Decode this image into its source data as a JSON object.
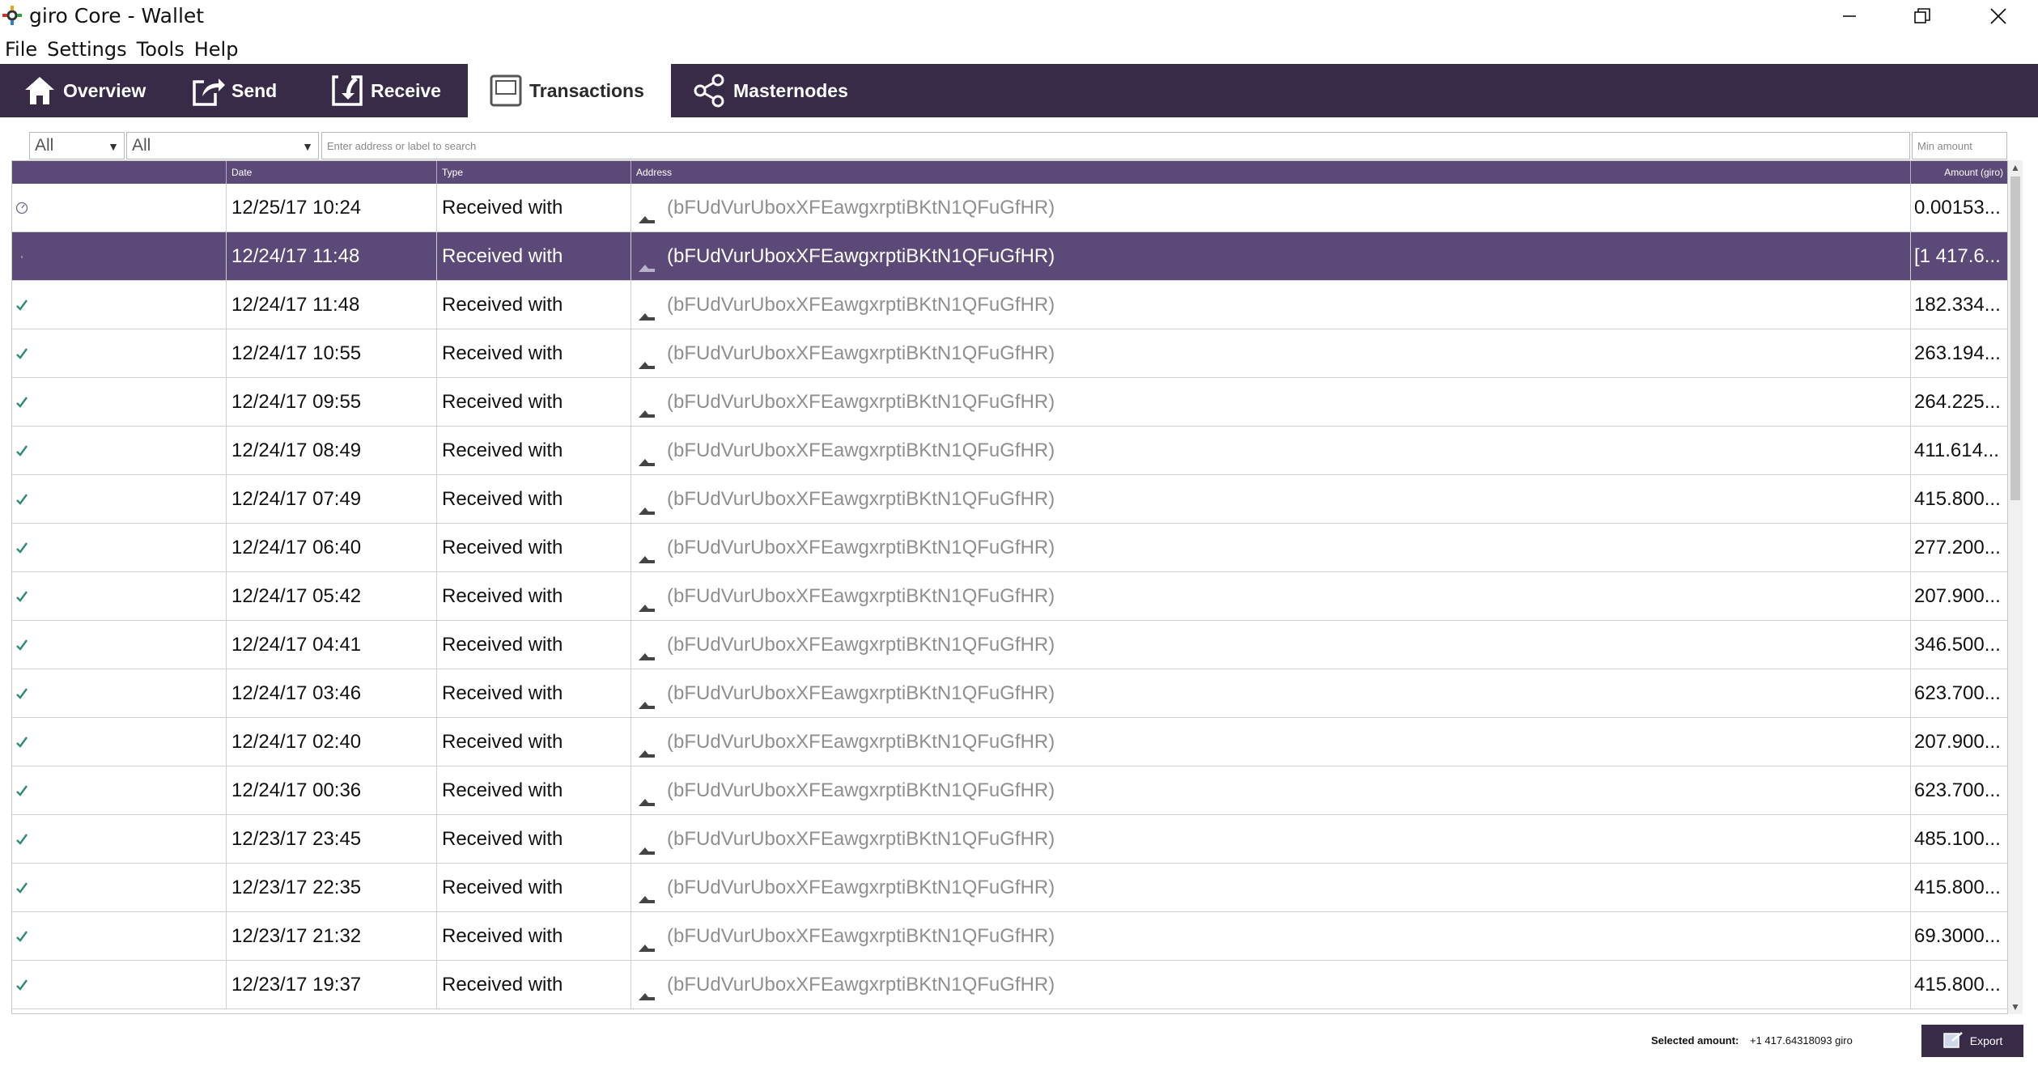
{
  "window": {
    "title": "giro Core - Wallet",
    "controls": {
      "minimize": "—",
      "maximize": "❐",
      "close": "✕"
    }
  },
  "menu": [
    "File",
    "Settings",
    "Tools",
    "Help"
  ],
  "tabs": [
    {
      "label": "Overview",
      "icon": "home-icon"
    },
    {
      "label": "Send",
      "icon": "send-icon"
    },
    {
      "label": "Receive",
      "icon": "receive-icon"
    },
    {
      "label": "Transactions",
      "icon": "transactions-icon",
      "active": true
    },
    {
      "label": "Masternodes",
      "icon": "share-nodes-icon"
    }
  ],
  "filters": {
    "date_value": "All",
    "type_value": "All",
    "search_placeholder": "Enter address or label to search",
    "amount_placeholder": "Min amount"
  },
  "table": {
    "headers": [
      "",
      "Date",
      "Type",
      "Address",
      "Amount (giro)"
    ],
    "rows": [
      {
        "status": "pending",
        "date": "12/25/17 10:24",
        "type": "Received with",
        "address": "(bFUdVurUboxXFEawgxrptiBKtN1QFuGfHR)",
        "amount": "0.00153..."
      },
      {
        "status": "selected",
        "date": "12/24/17 11:48",
        "type": "Received with",
        "address": "(bFUdVurUboxXFEawgxrptiBKtN1QFuGfHR)",
        "amount": "[1 417.6...",
        "selected": true
      },
      {
        "status": "confirmed",
        "date": "12/24/17 11:48",
        "type": "Received with",
        "address": "(bFUdVurUboxXFEawgxrptiBKtN1QFuGfHR)",
        "amount": "182.334..."
      },
      {
        "status": "confirmed",
        "date": "12/24/17 10:55",
        "type": "Received with",
        "address": "(bFUdVurUboxXFEawgxrptiBKtN1QFuGfHR)",
        "amount": "263.194..."
      },
      {
        "status": "confirmed",
        "date": "12/24/17 09:55",
        "type": "Received with",
        "address": "(bFUdVurUboxXFEawgxrptiBKtN1QFuGfHR)",
        "amount": "264.225..."
      },
      {
        "status": "confirmed",
        "date": "12/24/17 08:49",
        "type": "Received with",
        "address": "(bFUdVurUboxXFEawgxrptiBKtN1QFuGfHR)",
        "amount": "411.614..."
      },
      {
        "status": "confirmed",
        "date": "12/24/17 07:49",
        "type": "Received with",
        "address": "(bFUdVurUboxXFEawgxrptiBKtN1QFuGfHR)",
        "amount": "415.800..."
      },
      {
        "status": "confirmed",
        "date": "12/24/17 06:40",
        "type": "Received with",
        "address": "(bFUdVurUboxXFEawgxrptiBKtN1QFuGfHR)",
        "amount": "277.200..."
      },
      {
        "status": "confirmed",
        "date": "12/24/17 05:42",
        "type": "Received with",
        "address": "(bFUdVurUboxXFEawgxrptiBKtN1QFuGfHR)",
        "amount": "207.900..."
      },
      {
        "status": "confirmed",
        "date": "12/24/17 04:41",
        "type": "Received with",
        "address": "(bFUdVurUboxXFEawgxrptiBKtN1QFuGfHR)",
        "amount": "346.500..."
      },
      {
        "status": "confirmed",
        "date": "12/24/17 03:46",
        "type": "Received with",
        "address": "(bFUdVurUboxXFEawgxrptiBKtN1QFuGfHR)",
        "amount": "623.700..."
      },
      {
        "status": "confirmed",
        "date": "12/24/17 02:40",
        "type": "Received with",
        "address": "(bFUdVurUboxXFEawgxrptiBKtN1QFuGfHR)",
        "amount": "207.900..."
      },
      {
        "status": "confirmed",
        "date": "12/24/17 00:36",
        "type": "Received with",
        "address": "(bFUdVurUboxXFEawgxrptiBKtN1QFuGfHR)",
        "amount": "623.700..."
      },
      {
        "status": "confirmed",
        "date": "12/23/17 23:45",
        "type": "Received with",
        "address": "(bFUdVurUboxXFEawgxrptiBKtN1QFuGfHR)",
        "amount": "485.100..."
      },
      {
        "status": "confirmed",
        "date": "12/23/17 22:35",
        "type": "Received with",
        "address": "(bFUdVurUboxXFEawgxrptiBKtN1QFuGfHR)",
        "amount": "415.800..."
      },
      {
        "status": "confirmed",
        "date": "12/23/17 21:32",
        "type": "Received with",
        "address": "(bFUdVurUboxXFEawgxrptiBKtN1QFuGfHR)",
        "amount": "69.3000..."
      },
      {
        "status": "confirmed",
        "date": "12/23/17 19:37",
        "type": "Received with",
        "address": "(bFUdVurUboxXFEawgxrptiBKtN1QFuGfHR)",
        "amount": "415.800..."
      }
    ]
  },
  "footer": {
    "selected_label": "Selected amount:",
    "selected_value": "+1 417.64318093 giro",
    "export_label": "Export"
  },
  "colors": {
    "tabbar": "#382b47",
    "header": "#5b4a78",
    "selected_row": "#5b4a78",
    "check": "#2f8a7a"
  }
}
